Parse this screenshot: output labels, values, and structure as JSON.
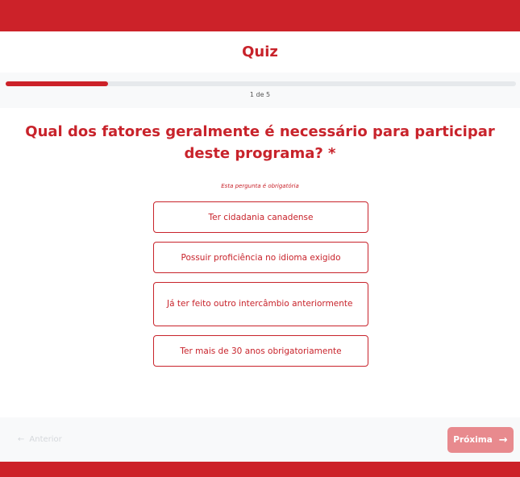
{
  "header": {
    "title": "Quiz"
  },
  "progress": {
    "current": 1,
    "total": 5,
    "fraction": 0.2,
    "label": "1 de 5"
  },
  "question": {
    "text": "Qual dos fatores geralmente é necessário para participar deste programa? *",
    "required_note": "Esta pergunta é obrigatória"
  },
  "options": [
    {
      "label": "Ter cidadania canadense"
    },
    {
      "label": "Possuir proficiência no idioma exigido"
    },
    {
      "label": "Já ter feito outro intercâmbio anteriormente"
    },
    {
      "label": "Ter mais de 30 anos obrigatoriamente"
    }
  ],
  "footer": {
    "prev_label": "Anterior",
    "next_label": "Próxima",
    "prev_icon": "arrow-left-icon",
    "next_icon": "arrow-right-icon"
  },
  "colors": {
    "brand": "#cc2229",
    "next_disabled": "#e88a8e"
  }
}
